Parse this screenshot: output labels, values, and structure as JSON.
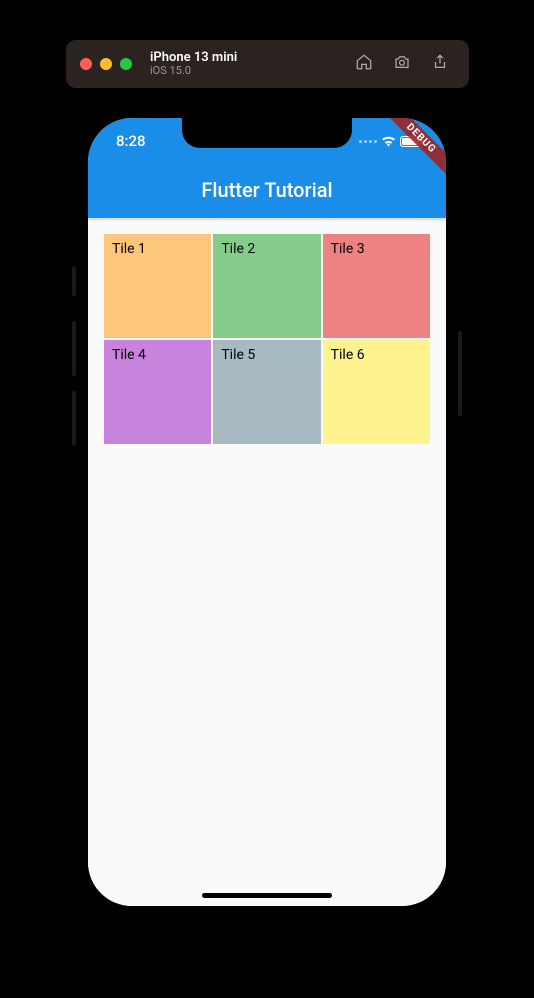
{
  "simulator": {
    "device": "iPhone 13 mini",
    "os": "iOS 15.0"
  },
  "status": {
    "time": "8:28"
  },
  "app": {
    "title": "Flutter Tutorial"
  },
  "debug_banner": "DEBUG",
  "grid": {
    "tiles": [
      {
        "label": "Tile 1",
        "color": "#fcc67b"
      },
      {
        "label": "Tile 2",
        "color": "#85cc8a"
      },
      {
        "label": "Tile 3",
        "color": "#ee8282"
      },
      {
        "label": "Tile 4",
        "color": "#c883dc"
      },
      {
        "label": "Tile 5",
        "color": "#a7bac1"
      },
      {
        "label": "Tile 6",
        "color": "#fdf38f"
      }
    ]
  }
}
